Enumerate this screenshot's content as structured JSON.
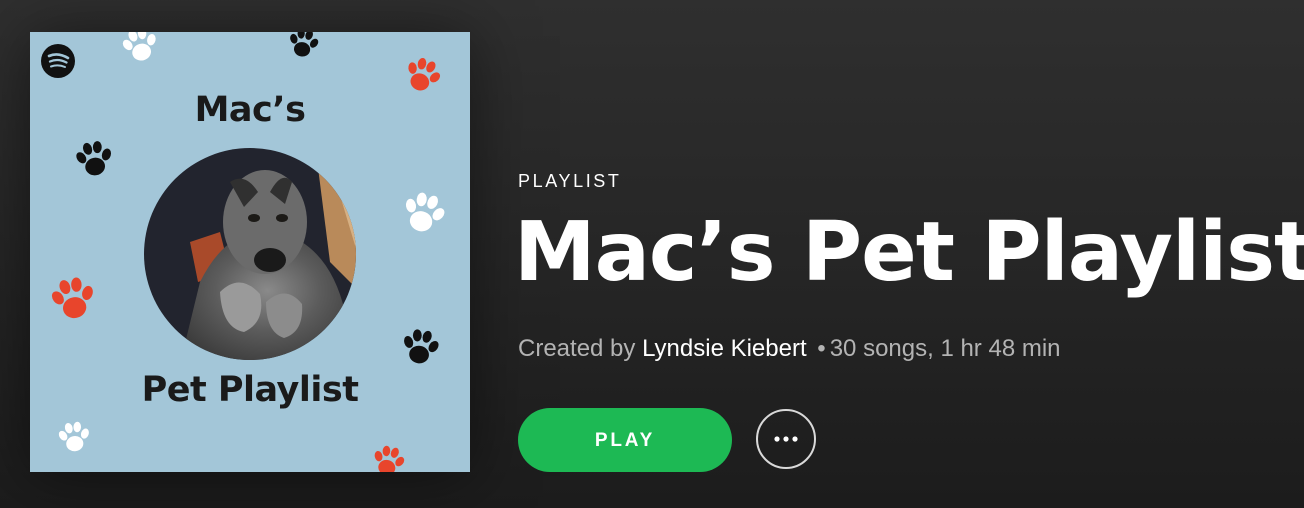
{
  "cover": {
    "line1": "Mac’s",
    "line2": "Pet Playlist",
    "logo_icon": "spotify-logo-icon",
    "background_color": "#a3c6d8",
    "paw_colors": [
      "#ffffff",
      "#111111",
      "#e8452c"
    ]
  },
  "playlist": {
    "type_label": "PLAYLIST",
    "title": "Mac’s Pet Playlist",
    "created_by_label": "Created by",
    "owner": "Lyndsie Kiebert",
    "separator": "•",
    "stats": "30 songs, 1 hr 48 min"
  },
  "actions": {
    "play_label": "PLAY",
    "more_icon": "more-horizontal-icon"
  },
  "colors": {
    "accent": "#1db954",
    "text_primary": "#ffffff",
    "text_secondary": "#b3b3b3"
  }
}
